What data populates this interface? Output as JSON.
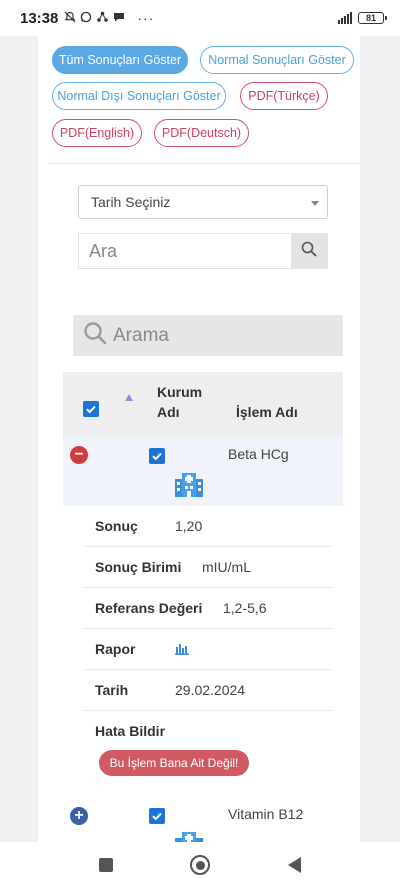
{
  "status_bar": {
    "time": "13:38",
    "dots": "···",
    "battery": "81"
  },
  "filters": {
    "all": "Tüm Sonuçları Göster",
    "normal": "Normal Sonuçları Göster",
    "abnormal": "Normal Dışı Sonuçları Göster",
    "pdf_tr": "PDF(Türkçe)",
    "pdf_en": "PDF(English)",
    "pdf_de": "PDF(Deutsch)"
  },
  "date_select": {
    "value": "Tarih Seçiniz"
  },
  "search": {
    "placeholder": "Ara"
  },
  "table_search": {
    "placeholder": "Arama"
  },
  "table": {
    "headers": {
      "institution_line1": "Kurum",
      "institution_line2": "Adı",
      "operation": "İşlem Adı"
    },
    "rows": [
      {
        "operation": "Beta HCg",
        "details": {
          "result_label": "Sonuç",
          "result_value": "1,20",
          "unit_label": "Sonuç Birimi",
          "unit_value": "mIU/mL",
          "reference_label": "Referans Değeri",
          "reference_value": "1,2-5,6",
          "report_label": "Rapor",
          "date_label": "Tarih",
          "date_value": "29.02.2024",
          "error_label": "Hata Bildir",
          "error_button": "Bu İşlem Bana Ait Değil!"
        }
      },
      {
        "operation": "Vitamin B12"
      }
    ]
  },
  "colors": {
    "accent_blue": "#5aa8e4",
    "accent_red": "#d7516b",
    "checkbox": "#1e73d8"
  }
}
